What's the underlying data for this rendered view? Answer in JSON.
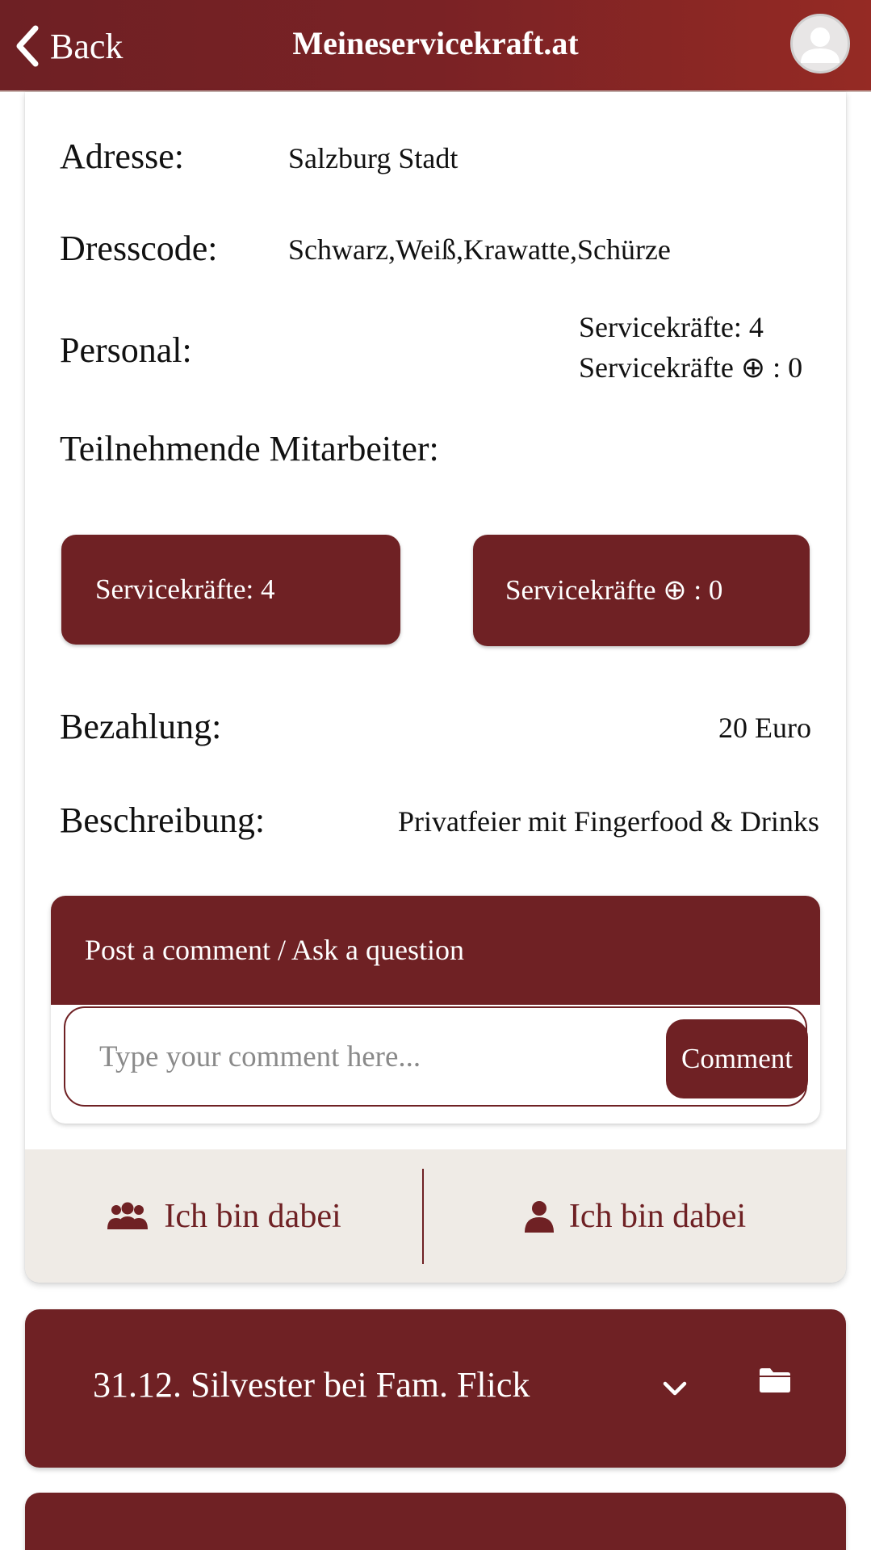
{
  "header": {
    "back_label": "Back",
    "title": "Meineservicekraft.at",
    "avatar_icon": "user-avatar-icon"
  },
  "details": {
    "address_label": "Adresse:",
    "address_value": "Salzburg Stadt",
    "dresscode_label": "Dresscode:",
    "dresscode_value": "Schwarz,Weiß,Krawatte,Schürze",
    "personal_label": "Personal:",
    "personal_line1": "Servicekräfte: 4",
    "personal_line2_prefix": "Servicekräfte",
    "personal_line2_suffix": ": 0",
    "participants_label": "Teilnehmende Mitarbeiter:",
    "payment_label": "Bezahlung:",
    "payment_value": "20 Euro",
    "description_label": "Beschreibung:",
    "description_value": "Privatfeier mit Fingerfood & Drinks"
  },
  "staff_buttons": {
    "servicekraefte": "Servicekräfte: 4",
    "servicekraefte_plus_prefix": "Servicekräfte",
    "servicekraefte_plus_suffix": ": 0"
  },
  "comments": {
    "header": "Post a comment / Ask a question",
    "placeholder": "Type your comment here...",
    "button_label": "Comment"
  },
  "join": {
    "group_label": "Ich bin dabei",
    "single_label": "Ich bin dabei"
  },
  "events": [
    {
      "title": "31.12. Silvester bei Fam. Flick"
    }
  ],
  "colors": {
    "primary": "#6f2124",
    "header_gradient_end": "#952a24",
    "join_bar_bg": "#efebe6"
  }
}
